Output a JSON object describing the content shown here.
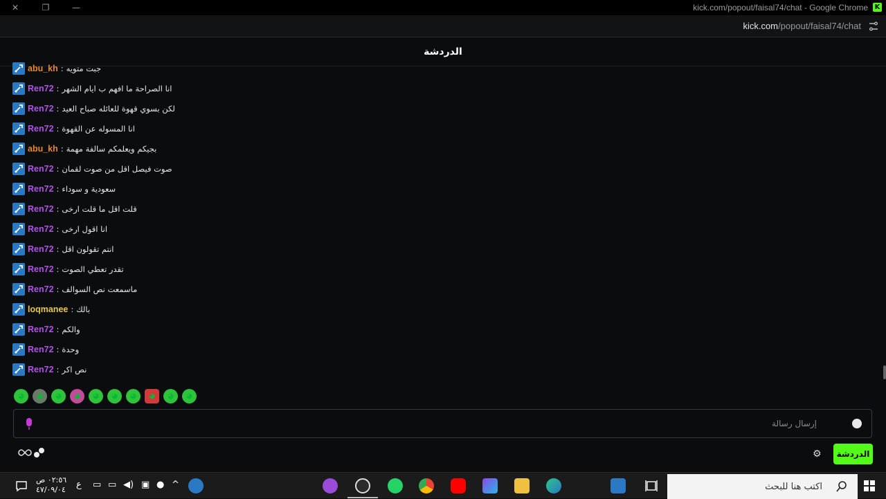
{
  "window": {
    "title": "kick.com/popout/faisal74/chat - Google Chrome",
    "kick_badge": "K",
    "url_host": "kick.com",
    "url_path": "/popout/faisal74/chat"
  },
  "chat": {
    "header_title": "الدردشة",
    "messages": [
      {
        "user": "abu_kh",
        "color": "#e8862a",
        "text": "جبت متويه"
      },
      {
        "user": "Ren72",
        "color": "#b153e8",
        "text": "انا الصراحة ما افهم ب ايام الشهر"
      },
      {
        "user": "Ren72",
        "color": "#b153e8",
        "text": "لكن بسوي قهوة للعائله صباح العيد"
      },
      {
        "user": "Ren72",
        "color": "#b153e8",
        "text": "انا المسوله عن القهوة"
      },
      {
        "user": "abu_kh",
        "color": "#e8862a",
        "text": "بجيكم ويعلمكم سالفة مهمة"
      },
      {
        "user": "Ren72",
        "color": "#b153e8",
        "text": "صوت فيصل اقل من صوت لقمان"
      },
      {
        "user": "Ren72",
        "color": "#b153e8",
        "text": "سعودية و سوداء"
      },
      {
        "user": "Ren72",
        "color": "#b153e8",
        "text": "قلت اقل ما قلت ارخى"
      },
      {
        "user": "Ren72",
        "color": "#b153e8",
        "text": "انا اقول ارخى"
      },
      {
        "user": "Ren72",
        "color": "#b153e8",
        "text": "انتم تقولون اقل"
      },
      {
        "user": "Ren72",
        "color": "#b153e8",
        "text": "تقدر تعطي الصوت"
      },
      {
        "user": "Ren72",
        "color": "#b153e8",
        "text": "ماسمعت نص السوالف"
      },
      {
        "user": "loqmanee",
        "color": "#e8c84a",
        "text": "بالك"
      },
      {
        "user": "Ren72",
        "color": "#b153e8",
        "text": "والكم"
      },
      {
        "user": "Ren72",
        "color": "#b153e8",
        "text": "وحدة"
      },
      {
        "user": "Ren72",
        "color": "#b153e8",
        "text": "نص اكر"
      }
    ],
    "input_placeholder": "إرسال رسالة",
    "send_label": "الدردشة",
    "accent_color": "#53fc18"
  },
  "taskbar": {
    "search_placeholder": "اكتب هنا للبحث",
    "clock_time": "٠٢:٥٦ ص",
    "clock_date": "٤٧/٠٩/٠٤",
    "language": "ع"
  }
}
